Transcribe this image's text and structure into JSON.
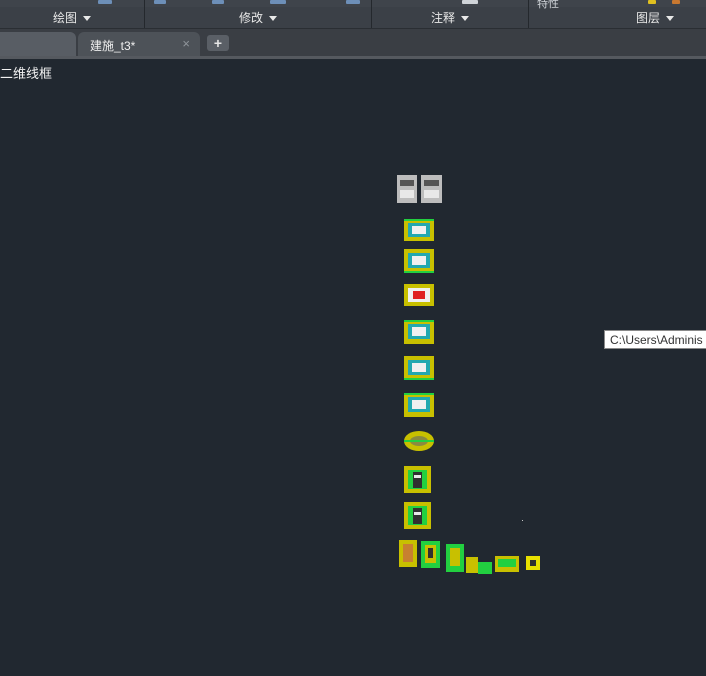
{
  "ribbon": {
    "panels": [
      {
        "label": "绘图"
      },
      {
        "label": "修改"
      },
      {
        "label": "注释"
      },
      {
        "label": "图层"
      }
    ],
    "partial_top_text": "特性"
  },
  "tabs": {
    "active_tab": "建施_t3*",
    "close_glyph": "×",
    "new_tab_glyph": "+"
  },
  "viewport": {
    "view_label": "二维线框"
  },
  "tooltip": {
    "text": "C:\\Users\\Adminis"
  },
  "colors": {
    "background": "#212830",
    "ribbon": "#3b4047",
    "drawing_yellow": "#e8e000",
    "drawing_green": "#22d040",
    "drawing_cyan": "#20d8e0",
    "drawing_red": "#e02020",
    "drawing_white": "#e8e8e8"
  }
}
